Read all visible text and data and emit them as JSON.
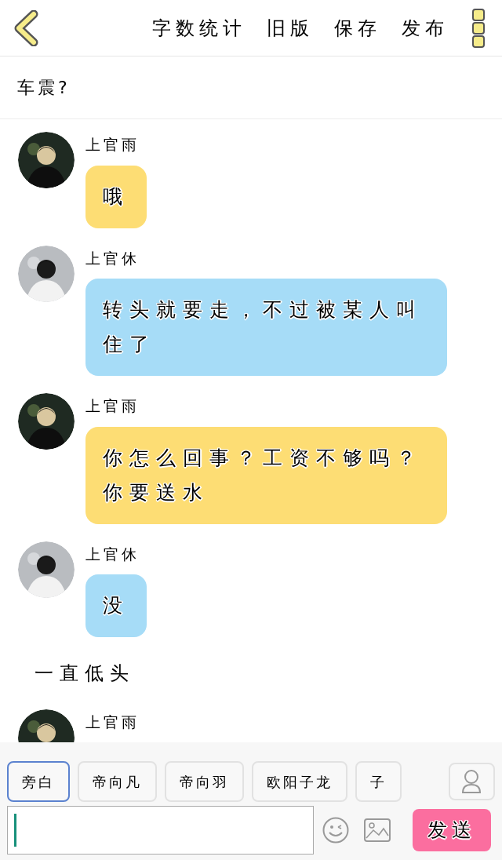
{
  "header": {
    "actions": [
      "字数统计",
      "旧版",
      "保存",
      "发布"
    ]
  },
  "title": "车震?",
  "messages": [
    {
      "kind": "bubble",
      "speaker": "上官雨",
      "text": "哦",
      "color": "#fddd74"
    },
    {
      "kind": "bubble",
      "speaker": "上官休",
      "text": "转头就要走，不过被某人叫住了",
      "color": "#a6dcf7"
    },
    {
      "kind": "bubble",
      "speaker": "上官雨",
      "text": "你怎么回事？工资不够吗？你要送水",
      "color": "#fddd74"
    },
    {
      "kind": "bubble",
      "speaker": "上官休",
      "text": "没",
      "color": "#a6dcf7"
    },
    {
      "kind": "narration",
      "text": "一直低头"
    },
    {
      "kind": "bubble",
      "speaker": "上官雨"
    }
  ],
  "roles": [
    {
      "label": "旁白",
      "selected": true
    },
    {
      "label": "帝向凡",
      "selected": false
    },
    {
      "label": "帝向羽",
      "selected": false
    },
    {
      "label": "欧阳子龙",
      "selected": false
    },
    {
      "label": "子",
      "selected": false
    }
  ],
  "send_button": "发送"
}
